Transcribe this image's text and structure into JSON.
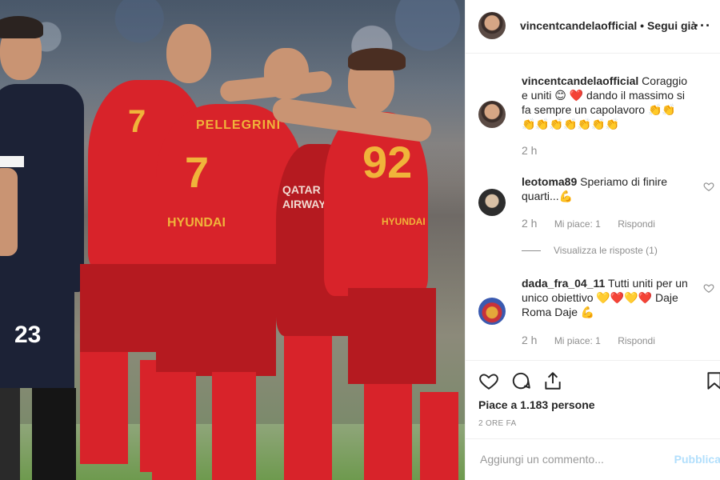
{
  "photo": {
    "jersey_numbers": [
      "7",
      "92",
      "23"
    ],
    "sponsor_text": "QATAR AIRWAYS",
    "brand_text": "HYUNDAI",
    "name_on_shirt": "PELLEGRINI"
  },
  "header": {
    "username": "vincentcandelaofficial",
    "separator": "•",
    "follow_label": "Segui già",
    "more_label": "···"
  },
  "comments": [
    {
      "username": "vincentcandelaofficial",
      "text": "Coraggio e uniti 😊 ❤️ dando il massimo si fa sempre un capolavoro 👏👏👏👏👏👏👏👏👏",
      "time": "2 h"
    },
    {
      "username": "leotoma89",
      "text": "Speriamo di finire quarti...💪",
      "time": "2 h",
      "likes": "Mi piace: 1",
      "reply": "Rispondi",
      "view_replies": "Visualizza le risposte (1)"
    },
    {
      "username": "dada_fra_04_11",
      "text": "Tutti uniti per un unico obiettivo 💛❤️💛❤️ Daje Roma Daje 💪",
      "time": "2 h",
      "likes": "Mi piace: 1",
      "reply": "Rispondi"
    }
  ],
  "actions": {
    "likes_text": "Piace a 1.183 persone",
    "time_ago": "2 ORE FA"
  },
  "add_comment": {
    "placeholder": "Aggiungi un commento...",
    "publish_label": "Pubblica"
  },
  "icons": {
    "heart": "heart-icon",
    "comment": "comment-bubble-icon",
    "share": "share-icon",
    "bookmark": "bookmark-icon",
    "more": "more-dots-icon"
  },
  "colors": {
    "roma_red": "#d8232a",
    "roma_gold": "#f0b43a",
    "opponent_navy": "#1c2236",
    "publish_blue": "#b2dffc",
    "meta_gray": "#8e8e8e"
  }
}
